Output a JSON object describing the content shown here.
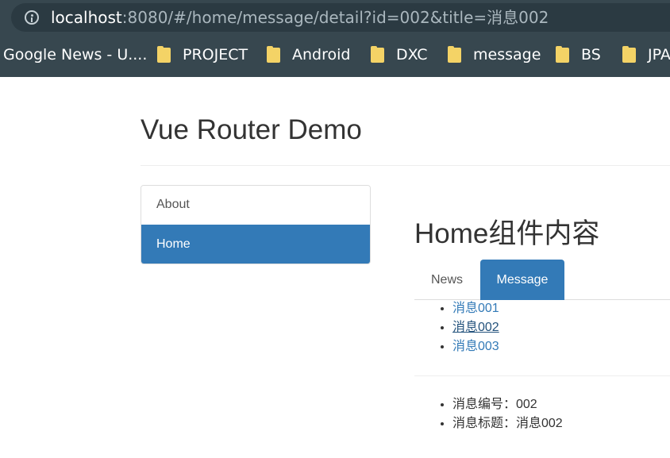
{
  "browser": {
    "url_host": "localhost",
    "url_rest": ":8080/#/home/message/detail?id=002&title=消息002",
    "bookmarks": [
      {
        "label": "Google News - U....",
        "folder": false
      },
      {
        "label": "PROJECT",
        "folder": true
      },
      {
        "label": "Android",
        "folder": true
      },
      {
        "label": "DXC",
        "folder": true
      },
      {
        "label": "message",
        "folder": true
      },
      {
        "label": "BS",
        "folder": true
      },
      {
        "label": "JPA",
        "folder": true
      }
    ]
  },
  "page": {
    "title": "Vue Router Demo"
  },
  "sidebar": {
    "items": [
      {
        "label": "About",
        "active": false
      },
      {
        "label": "Home",
        "active": true
      }
    ]
  },
  "home": {
    "heading": "Home组件内容",
    "tabs": [
      {
        "label": "News",
        "active": false
      },
      {
        "label": "Message",
        "active": true
      }
    ],
    "messages": [
      {
        "label": "消息001"
      },
      {
        "label": "消息002"
      },
      {
        "label": "消息003"
      }
    ],
    "detail": {
      "id_line": "消息编号：002",
      "title_line": "消息标题：消息002"
    }
  }
}
